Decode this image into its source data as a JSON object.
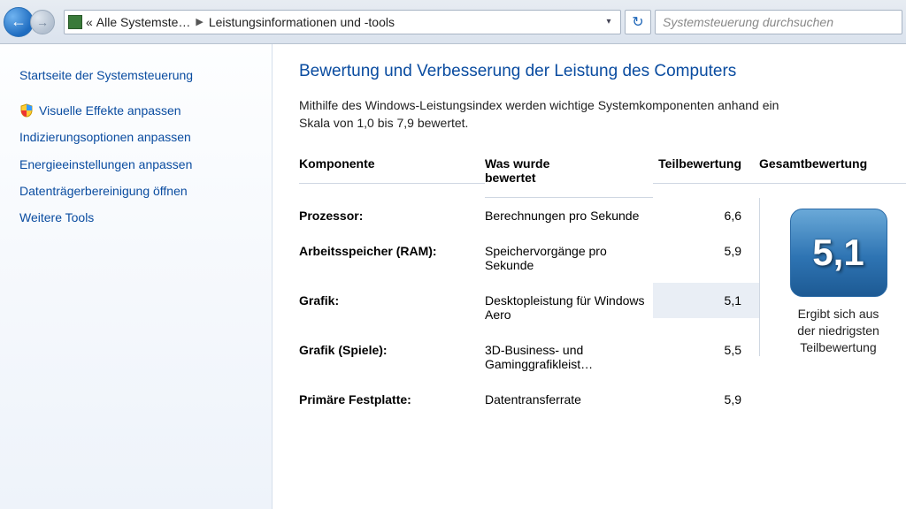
{
  "breadcrumbs": {
    "root_prefix": "«",
    "root": "Alle Systemste…",
    "current": "Leistungsinformationen und -tools"
  },
  "search": {
    "placeholder": "Systemsteuerung durchsuchen"
  },
  "sidebar": {
    "home": "Startseite der Systemsteuerung",
    "items": [
      "Visuelle Effekte anpassen",
      "Indizierungsoptionen anpassen",
      "Energieeinstellungen anpassen",
      "Datenträgerbereinigung öffnen",
      "Weitere Tools"
    ]
  },
  "page": {
    "title": "Bewertung und Verbesserung der Leistung des Computers",
    "intro_l1": "Mithilfe des Windows-Leistungsindex werden wichtige Systemkomponenten anhand ein",
    "intro_l2": "Skala von 1,0 bis 7,9 bewertet."
  },
  "table": {
    "col_component": "Komponente",
    "col_what_l1": "Was wurde",
    "col_what_l2": "bewertet",
    "col_sub": "Teilbewertung",
    "col_total": "Gesamtbewertung",
    "rows": [
      {
        "component": "Prozessor:",
        "what": "Berechnungen pro Sekunde",
        "score": "6,6"
      },
      {
        "component": "Arbeitsspeicher (RAM):",
        "what": "Speichervorgänge pro Sekunde",
        "score": "5,9"
      },
      {
        "component": "Grafik:",
        "what": "Desktopleistung für Windows Aero",
        "score": "5,1",
        "highlight": true
      },
      {
        "component": "Grafik (Spiele):",
        "what": "3D-Business- und Gaminggrafikleist…",
        "score": "5,5"
      },
      {
        "component": "Primäre Festplatte:",
        "what": "Datentransferrate",
        "score": "5,9"
      }
    ],
    "overall_score": "5,1",
    "overall_caption_l1": "Ergibt sich aus",
    "overall_caption_l2": "der niedrigsten",
    "overall_caption_l3": "Teilbewertung"
  }
}
